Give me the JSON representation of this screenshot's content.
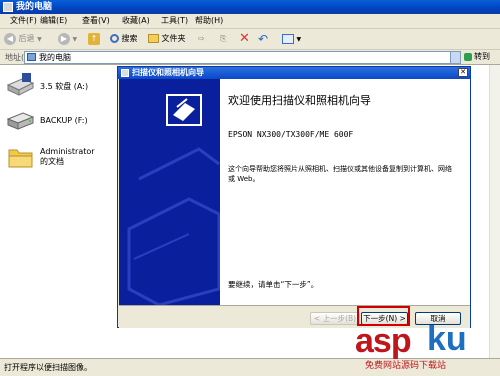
{
  "window": {
    "title": "我的电脑"
  },
  "menu": [
    "文件(F)",
    "编辑(E)",
    "查看(V)",
    "收藏(A)",
    "工具(T)",
    "帮助(H)"
  ],
  "toolbar": {
    "back": "后退",
    "search": "搜索",
    "folders": "文件夹"
  },
  "address": {
    "label": "地址(D)",
    "value": "我的电脑",
    "go": "转到"
  },
  "items": [
    {
      "label": "3.5 软盘 (A:)",
      "icon": "floppy-drive-icon"
    },
    {
      "label": "BACKUP (F:)",
      "icon": "hard-drive-icon"
    },
    {
      "label": "Administrator 的文档",
      "icon": "folder-icon"
    }
  ],
  "dialog": {
    "title": "扫描仪和照相机向导",
    "heading": "欢迎使用扫描仪和照相机向导",
    "model": "EPSON NX300/TX300F/ME 600F",
    "description": "这个向导帮助您将照片从照相机、扫描仪或其他设备复制到计算机、网络或 Web。",
    "continue_hint": "要继续，请单击“下一步”。",
    "buttons": {
      "back": "< 上一步(B)",
      "next": "下一步(N) >",
      "cancel": "取消"
    }
  },
  "status": {
    "text": "打开程序以便扫描图像。"
  },
  "watermark": {
    "main": "aspku",
    "sub": "免费网站源码下载站"
  },
  "colors": {
    "xp_blue": "#0a48c8",
    "wizard_side": "#0a1f9b",
    "highlight": "#d10000"
  }
}
